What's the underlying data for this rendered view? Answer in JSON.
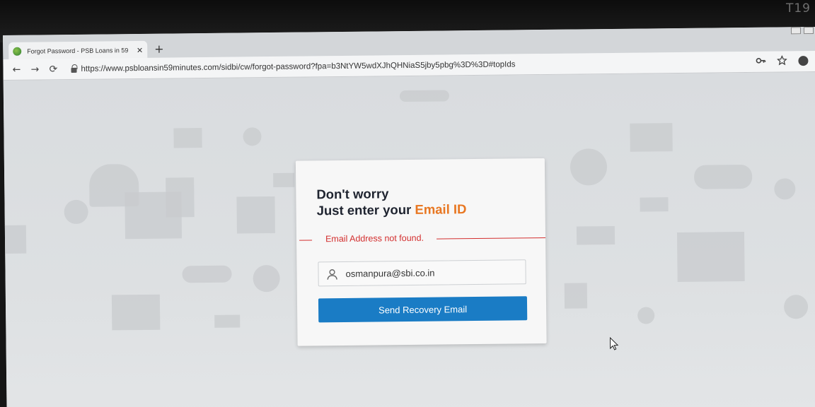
{
  "monitor": {
    "label": "T19"
  },
  "browser": {
    "tab": {
      "title": "Forgot Password - PSB Loans in 59",
      "close_glyph": "✕",
      "favicon": "psb-leaf-icon"
    },
    "new_tab_glyph": "+",
    "nav": {
      "back_glyph": "←",
      "forward_glyph": "→",
      "reload_glyph": "⟳"
    },
    "url": "https://www.psbloansin59minutes.com/sidbi/cw/forgot-password?fpa=b3NtYW5wdXJhQHNiaS5jby5pbg%3D%3D#topIds",
    "toolbar_icons": [
      "key-icon",
      "star-icon",
      "account-icon"
    ]
  },
  "card": {
    "heading_line1": "Don't worry",
    "heading_line2_prefix": "Just enter your ",
    "heading_line2_accent": "Email ID",
    "error_message": "Email Address not found.",
    "email_value": "osmanpura@sbi.co.in",
    "submit_label": "Send Recovery Email"
  },
  "colors": {
    "accent": "#e87722",
    "error": "#d32f2f",
    "primary_button": "#1a7cc5"
  }
}
